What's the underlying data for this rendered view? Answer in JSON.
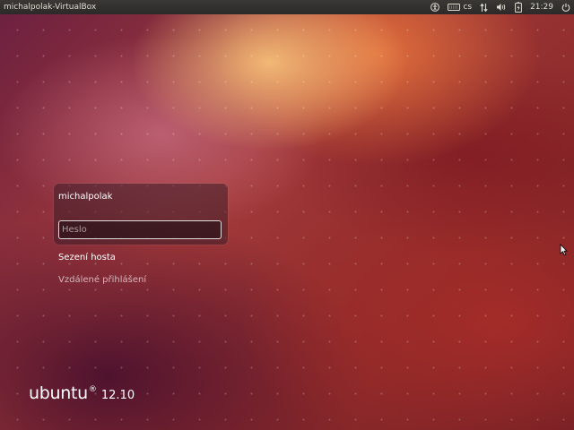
{
  "topbar": {
    "title": "michalpolak-VirtualBox",
    "indicators": {
      "accessibility_icon": "accessibility-icon",
      "keyboard_icon": "keyboard-icon",
      "keyboard_layout": "cs",
      "network_icon": "network-icon",
      "sound_icon": "sound-icon",
      "battery_icon": "battery-icon",
      "clock": "21:29",
      "power_icon": "power-icon"
    }
  },
  "login": {
    "username": "michalpolak",
    "password_placeholder": "Heslo",
    "guest_session": "Sezení hosta",
    "remote_login": "Vzdálené přihlášení"
  },
  "branding": {
    "name": "ubuntu",
    "mark": "®",
    "version": "12.10"
  }
}
